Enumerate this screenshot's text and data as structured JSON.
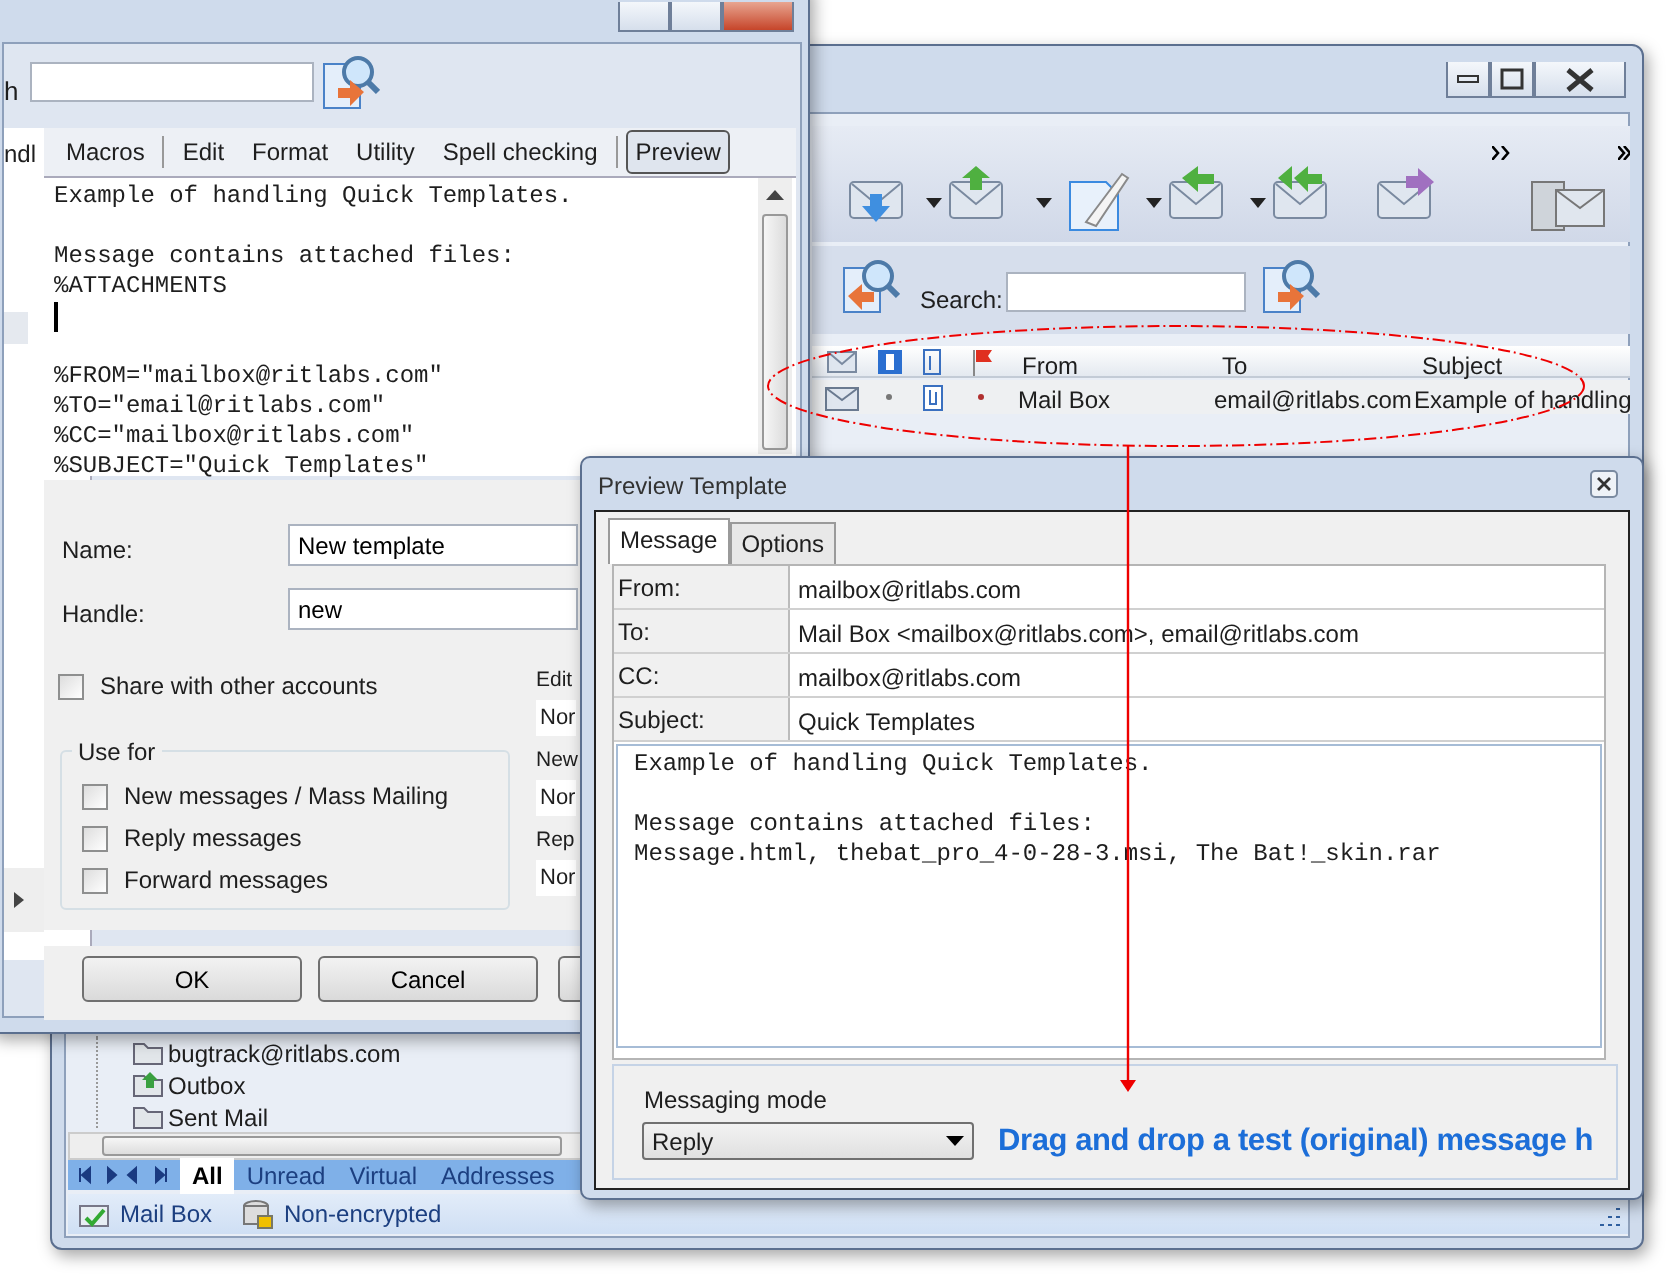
{
  "mail_window": {
    "search_label": "Search:",
    "columns": [
      "From",
      "To",
      "Subject"
    ],
    "rows": [
      {
        "from": "Mail Box",
        "to": "email@ritlabs.com",
        "subject": "Example of handling",
        "selected": true
      }
    ],
    "folders": [
      "bugtrack@ritlabs.com",
      "Outbox",
      "Sent Mail"
    ],
    "folder_tabs": [
      {
        "label": "All",
        "selected": true
      },
      {
        "label": "Unread",
        "selected": false
      },
      {
        "label": "Virtual",
        "selected": false
      },
      {
        "label": "Addresses",
        "selected": false
      }
    ],
    "status_bar": [
      "Mail Box",
      "Non-encrypted"
    ]
  },
  "template_editor": {
    "search_label": "h",
    "side_tab": "ndl",
    "menu": [
      {
        "label": "Macros",
        "selected": false
      },
      {
        "label": "Edit",
        "selected": false
      },
      {
        "label": "Format",
        "selected": false
      },
      {
        "label": "Utility",
        "selected": false
      },
      {
        "label": "Spell checking",
        "selected": false
      },
      {
        "label": "Preview",
        "selected": true
      }
    ],
    "body": [
      "Example of handling Quick Templates.\n\nMessage contains attached files:\n%ATTACHMENTS",
      "%FROM=\"mailbox@ritlabs.com\"\n%TO=\"email@ritlabs.com\"\n%CC=\"mailbox@ritlabs.com\"\n%SUBJECT=\"Quick Templates\""
    ],
    "fields": [
      {
        "label": "Name:",
        "value": "New template"
      },
      {
        "label": "Handle:",
        "value": "new"
      }
    ],
    "share": {
      "label": "Share with other accounts",
      "checked": false
    },
    "use_for": {
      "title": "Use for",
      "options": [
        {
          "label": "New messages / Mass Mailing",
          "checked": false
        },
        {
          "label": "Reply messages",
          "checked": false
        },
        {
          "label": "Forward messages",
          "checked": false
        }
      ]
    },
    "side_fields": [
      {
        "label": "Edit",
        "value": "Nor"
      },
      {
        "label": "New",
        "value": "Nor"
      },
      {
        "label": "Rep",
        "value": "Nor"
      }
    ],
    "buttons": [
      "OK",
      "Cancel"
    ]
  },
  "preview": {
    "title": "Preview Template",
    "tabs": [
      {
        "label": "Message",
        "selected": true
      },
      {
        "label": "Options",
        "selected": false
      }
    ],
    "fields": [
      {
        "label": "From:",
        "value": "mailbox@ritlabs.com"
      },
      {
        "label": "To:",
        "value": "Mail Box <mailbox@ritlabs.com>, email@ritlabs.com"
      },
      {
        "label": "CC:",
        "value": "mailbox@ritlabs.com"
      },
      {
        "label": "Subject:",
        "value": "Quick Templates"
      }
    ],
    "body": "Example of handling Quick Templates.\n\nMessage contains attached files:\nMessage.html, thebat_pro_4-0-28-3.msi, The Bat!_skin.rar",
    "messaging_mode": {
      "label": "Messaging mode",
      "value": "Reply"
    },
    "hint": "Drag and drop a test (original) message h"
  }
}
